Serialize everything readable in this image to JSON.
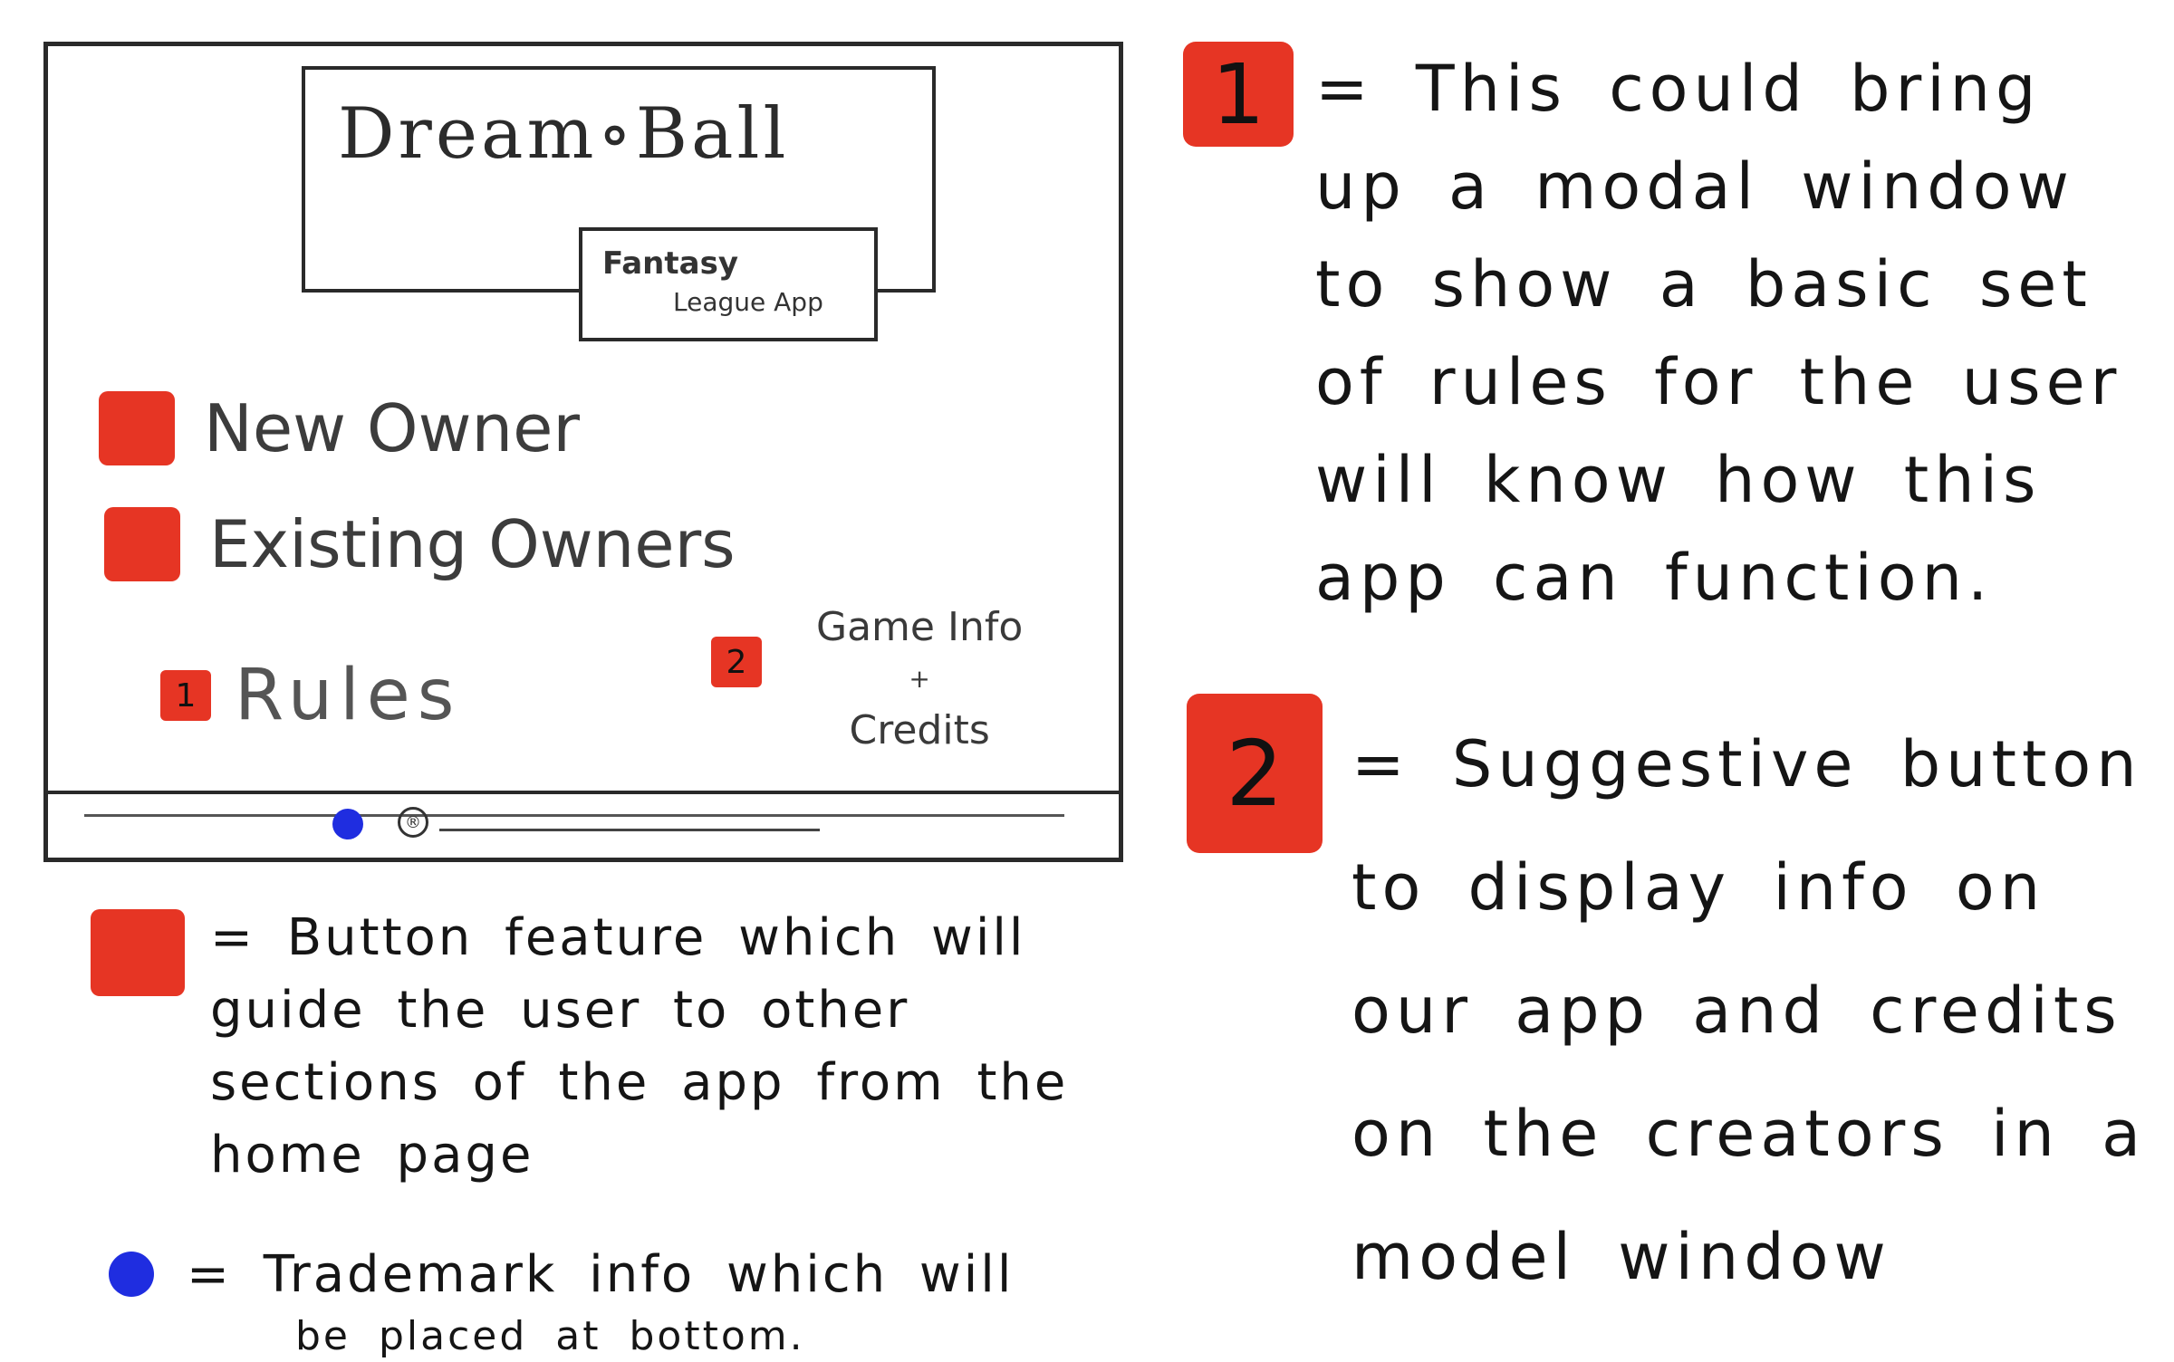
{
  "mockup": {
    "logo_title": "Dream∘Ball",
    "logo_subtitle_line1": "Fantasy",
    "logo_subtitle_line2": "League App",
    "menu": {
      "new_owner": "New Owner",
      "existing_owners": "Existing Owners",
      "rules_badge": "1",
      "rules": "Rules",
      "game_info_badge": "2",
      "game_info_line1": "Game Info",
      "game_info_line2": "+",
      "game_info_line3": "Credits"
    },
    "trademark_symbol": "®"
  },
  "notes": {
    "note1_badge": "1",
    "note1_text": "= This could bring up a modal window to show a basic set of rules for the user will know how this app can function.",
    "note2_badge": "2",
    "note2_text": "= Suggestive button to display info on our app and credits on the creators in a model window"
  },
  "legend": {
    "button_text": "= Button feature which will guide the user to other sections of the app from the home page",
    "trademark_text_line1": "= Trademark info which will",
    "trademark_text_line2": "be placed at bottom."
  },
  "colors": {
    "red": "#e63524",
    "blue": "#1f2de0"
  }
}
